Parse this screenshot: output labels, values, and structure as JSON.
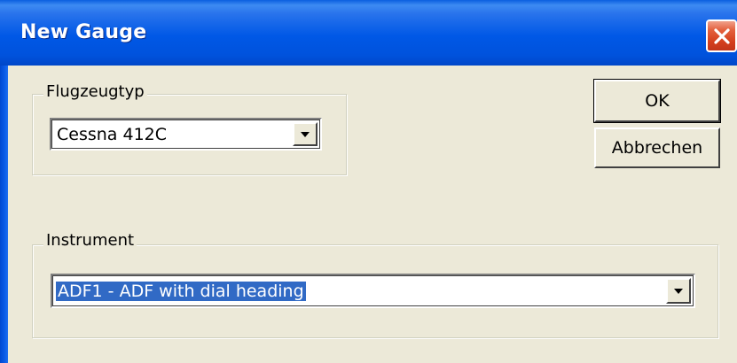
{
  "window": {
    "title": "New Gauge",
    "close_icon": "close-icon"
  },
  "aircraft_group": {
    "label": "Flugzeugtyp",
    "selected_value": "Cessna 412C"
  },
  "instrument_group": {
    "label": "Instrument",
    "selected_value": "ADF1 - ADF with dial heading"
  },
  "buttons": {
    "ok_label": "OK",
    "cancel_label": "Abbrechen"
  },
  "colors": {
    "titlebar": "#0058e6",
    "dialog_bg": "#ece9d8",
    "selection": "#316ac5",
    "close_button": "#d4401d"
  }
}
